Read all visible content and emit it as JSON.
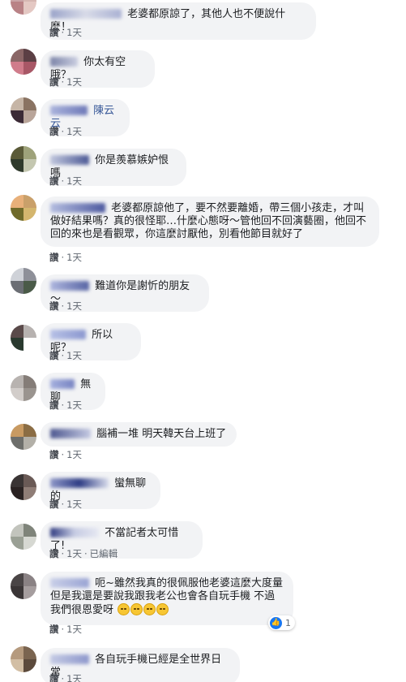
{
  "comments": [
    {
      "text": "老婆都原諒了，其他人也不便說什麼！",
      "like": "讚",
      "time": "1天"
    },
    {
      "text": "你太有空哦？",
      "like": "讚",
      "time": "1天"
    },
    {
      "text": "陳云云",
      "like": "讚",
      "time": "1天"
    },
    {
      "text": "你是羨慕嫉妒恨嗎",
      "like": "讚",
      "time": "1天"
    },
    {
      "text": "老婆都原諒他了，要不然要離婚，帶三個小孩走，才叫做好結果嗎？真的很怪耶…什麼心態呀～管他回不回演藝圈，他回不回的來也是看觀眾，你這麼討厭他，別看他節目就好了",
      "like": "讚",
      "time": "1天"
    },
    {
      "text": "難道你是謝忻的朋友～",
      "like": "讚",
      "time": "1天"
    },
    {
      "text": "所以呢？",
      "like": "讚",
      "time": "1天"
    },
    {
      "text": "無聊",
      "like": "讚",
      "time": "1天"
    },
    {
      "text": "腦補一堆 明天韓天台上班了",
      "like": "讚",
      "time": "1天"
    },
    {
      "text": "蠻無聊的",
      "like": "讚",
      "time": "1天"
    },
    {
      "text": "不當記者太可惜了!",
      "like": "讚",
      "time": "1天",
      "edited": "已編輯"
    },
    {
      "text": "呃~雖然我真的很佩服他老婆這麼大度量 但是我還是要說我跟我老公也會各自玩手機 不過我們很恩愛呀",
      "like": "讚",
      "time": "1天",
      "reaction_count": "1"
    },
    {
      "text": "各自玩手機已經是全世界日常",
      "like": "讚",
      "time": "1天"
    }
  ],
  "colors": {
    "bubble": "#f2f3f5",
    "meta": "#606770",
    "like_blue": "#1877f2"
  },
  "icons": {
    "reaction": "like-icon",
    "emoji": "rolling-eyes-emoji-icon"
  }
}
